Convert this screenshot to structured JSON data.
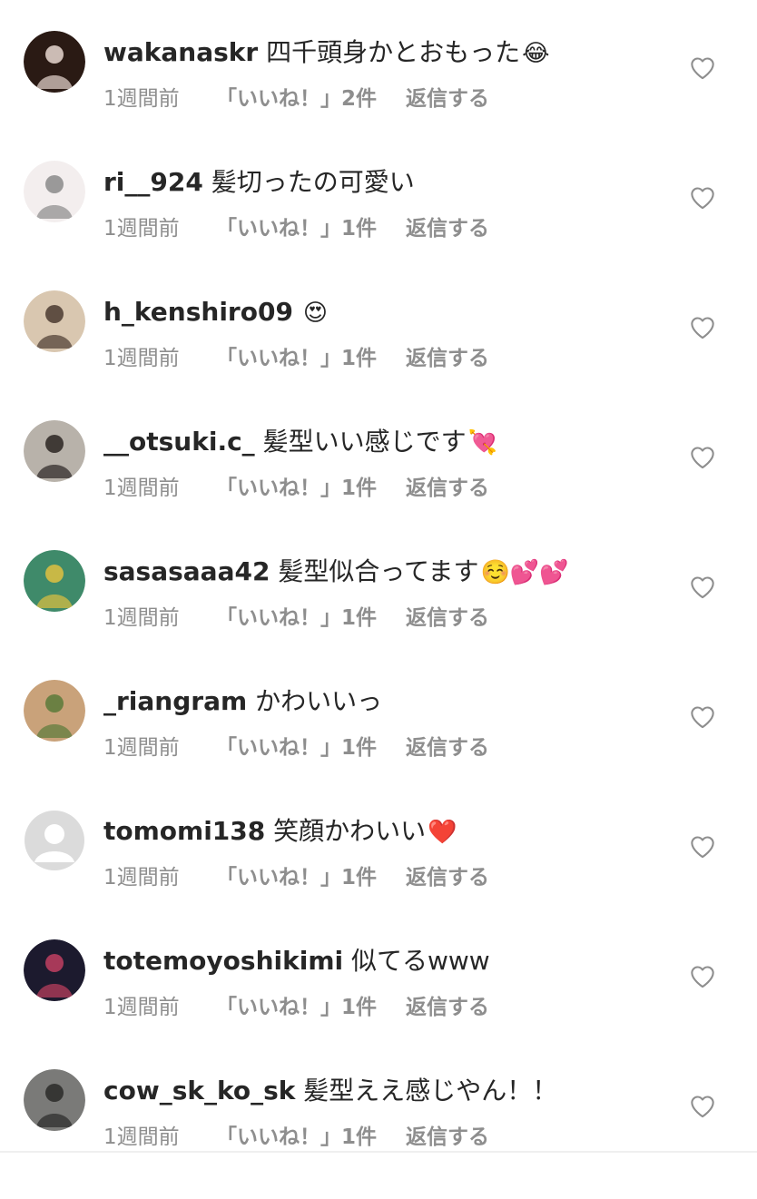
{
  "comments": [
    {
      "username": "wakanaskr",
      "text": "四千頭身かとおもった",
      "emoji": "😂",
      "time": "1週間前",
      "likes": "「いいね！」2件",
      "reply": "返信する",
      "avatar_colors": [
        "#2a1a14",
        "#e8d8d0"
      ]
    },
    {
      "username": "ri__924",
      "text": "髪切ったの可愛い",
      "emoji": "",
      "time": "1週間前",
      "likes": "「いいね！」1件",
      "reply": "返信する",
      "avatar_colors": [
        "#f3eeee",
        "#8a8a8a"
      ]
    },
    {
      "username": "h_kenshiro09",
      "text": "",
      "emoji": "😍",
      "time": "1週間前",
      "likes": "「いいね！」1件",
      "reply": "返信する",
      "avatar_colors": [
        "#d9c7b0",
        "#4a3a30"
      ]
    },
    {
      "username": "__otsuki.c_",
      "text": "髪型いい感じです",
      "emoji": "💘",
      "time": "1週間前",
      "likes": "「いいね！」1件",
      "reply": "返信する",
      "avatar_colors": [
        "#b8b2aa",
        "#2a2422"
      ]
    },
    {
      "username": "sasasaaa42",
      "text": "髪型似合ってます",
      "emoji": "☺️💕💕",
      "time": "1週間前",
      "likes": "「いいね！」1件",
      "reply": "返信する",
      "avatar_colors": [
        "#3f8a6a",
        "#e0c040"
      ]
    },
    {
      "username": "_riangram",
      "text": "かわいいっ",
      "emoji": "",
      "time": "1週間前",
      "likes": "「いいね！」1件",
      "reply": "返信する",
      "avatar_colors": [
        "#c9a27a",
        "#5a7a3a"
      ]
    },
    {
      "username": "tomomi138",
      "text": "笑顔かわいい",
      "emoji": "❤️",
      "time": "1週間前",
      "likes": "「いいね！」1件",
      "reply": "返信する",
      "avatar_colors": [
        "#dbdbdb",
        "#ffffff"
      ]
    },
    {
      "username": "totemoyoshikimi",
      "text": "似てるwww",
      "emoji": "",
      "time": "1週間前",
      "likes": "「いいね！」1件",
      "reply": "返信する",
      "avatar_colors": [
        "#1c1a2e",
        "#c04060"
      ]
    },
    {
      "username": "cow_sk_ko_sk",
      "text": "髪型ええ感じやん！！",
      "emoji": "",
      "time": "1週間前",
      "likes": "「いいね！」1件",
      "reply": "返信する",
      "avatar_colors": [
        "#7a7a78",
        "#2a2a28"
      ]
    }
  ]
}
